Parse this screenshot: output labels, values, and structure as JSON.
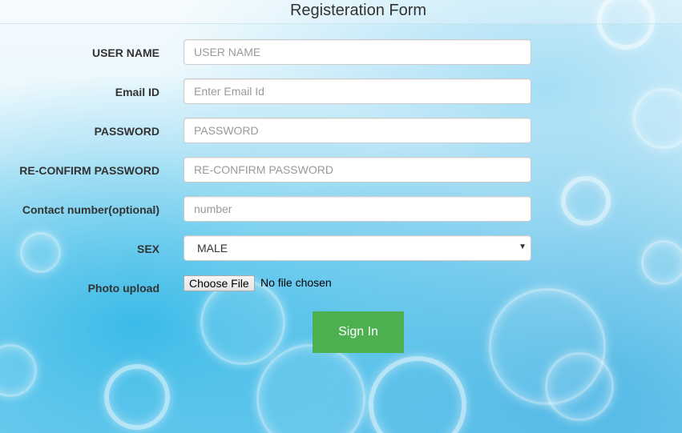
{
  "form": {
    "title": "Registeration Form",
    "fields": {
      "username": {
        "label": "USER NAME",
        "placeholder": "USER NAME",
        "value": ""
      },
      "email": {
        "label": "Email ID",
        "placeholder": "Enter Email Id",
        "value": ""
      },
      "password": {
        "label": "PASSWORD",
        "placeholder": "PASSWORD",
        "value": ""
      },
      "reconfirm": {
        "label": "RE-CONFIRM PASSWORD",
        "placeholder": "RE-CONFIRM PASSWORD",
        "value": ""
      },
      "contact": {
        "label": "Contact number(optional)",
        "placeholder": "number",
        "value": ""
      },
      "sex": {
        "label": "SEX",
        "selected": "MALE"
      },
      "photo": {
        "label": "Photo upload",
        "button": "Choose File",
        "status": "No file chosen"
      }
    },
    "submit_label": "Sign In"
  },
  "colors": {
    "submit_bg": "#4caf50",
    "background_accent": "#8fd6f2"
  }
}
